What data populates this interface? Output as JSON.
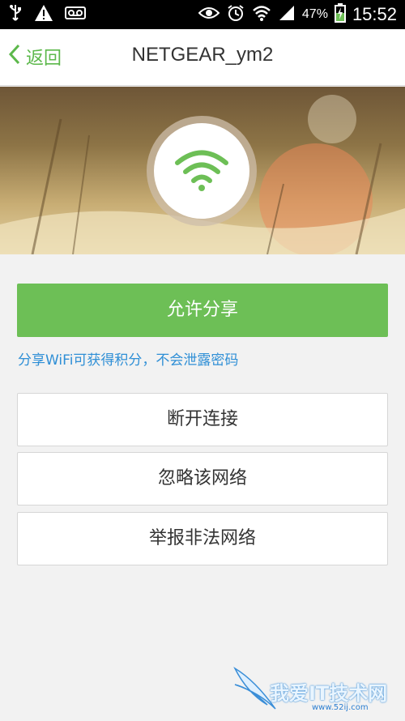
{
  "status_bar": {
    "battery_percent": "47%",
    "time": "15:52",
    "icons_left": [
      "usb-icon",
      "warning-icon",
      "voicemail-icon"
    ],
    "icons_right": [
      "eye-icon",
      "alarm-icon",
      "wifi-signal-icon",
      "cell-signal-icon",
      "battery-charging-icon"
    ]
  },
  "header": {
    "back_label": "返回",
    "title": "NETGEAR_ym2"
  },
  "banner": {
    "icon": "wifi-icon",
    "accent": "#6dbf56"
  },
  "actions": {
    "allow_share_label": "允许分享",
    "hint": "分享WiFi可获得积分，不会泄露密码",
    "disconnect_label": "断开连接",
    "ignore_label": "忽略该网络",
    "report_label": "举报非法网络"
  },
  "watermark": {
    "text": "我爱IT技术网",
    "sub": "www.52ij.com"
  },
  "colors": {
    "primary": "#6dbf56",
    "link": "#2f8fd6",
    "background": "#f2f2f2"
  }
}
